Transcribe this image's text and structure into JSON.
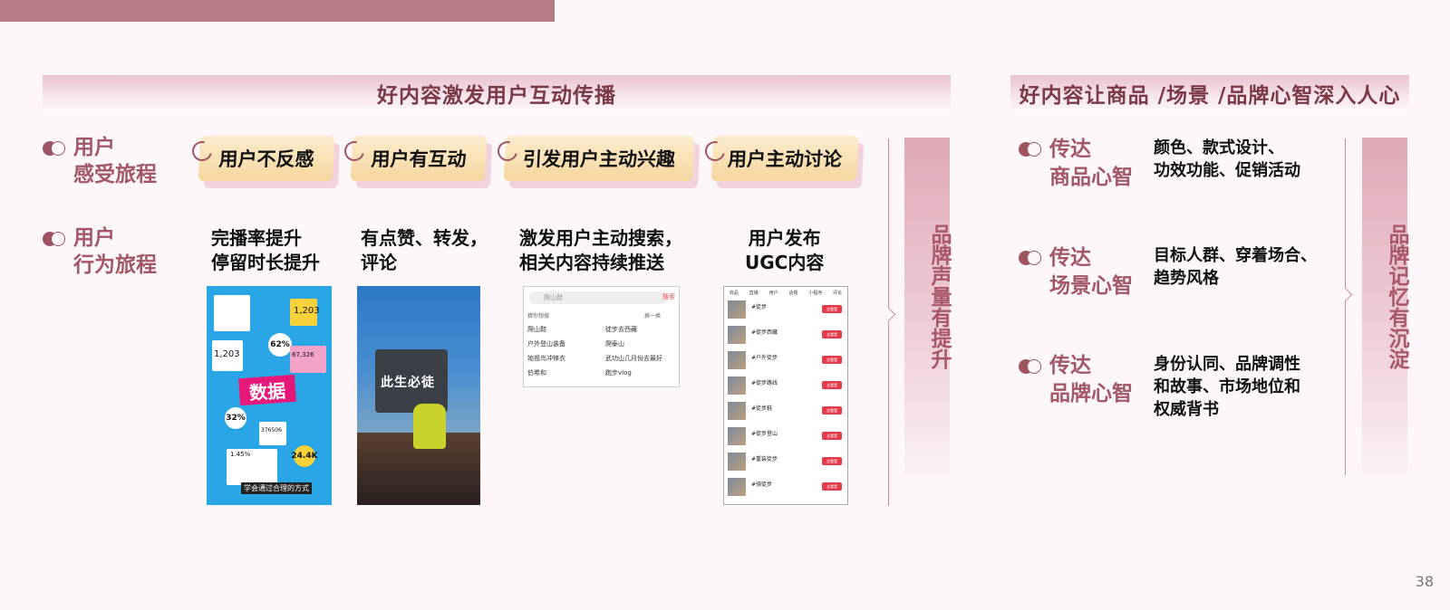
{
  "headers": {
    "left": "好内容激发用户互动传播",
    "right": "好内容让商品 /场景 /品牌心智深入人心"
  },
  "rows": {
    "feeling": "用户\n感受旅程",
    "behavior": "用户\n行为旅程"
  },
  "tags": [
    "用户不反感",
    "用户有互动",
    "引发用户主动兴趣",
    "用户主动讨论"
  ],
  "behaviors": [
    "完播率提升\n停留时长提升",
    "有点赞、转发，\n评论",
    "激发用户主动搜索，\n相关内容持续推送",
    "用户发布\nUGC内容"
  ],
  "screens": {
    "data_card": {
      "big_word": "数据",
      "num1": "1,203",
      "num2": "1,203",
      "pct1": "62%",
      "pct2": "32%",
      "num3": "67,326",
      "num4": "376506",
      "num5": "24.4K",
      "pct3": "1.45%",
      "caption": "学会通过合理的方式"
    },
    "video": {
      "sign": "此生必徒"
    },
    "search": {
      "placeholder": "爬山鞋",
      "search_btn": "搜索",
      "guess": "猜你想搜",
      "refresh": "换一换",
      "items": [
        "爬山鞋",
        "徒步去西藏",
        "户外登山装备",
        "爬泰山",
        "始祖鸟冲锋衣",
        "武功山几月份去最好",
        "伯希和",
        "跑步vlog"
      ]
    },
    "list": {
      "tabs": [
        "商品",
        "直播",
        "用户",
        "话题",
        "小程序",
        "评论"
      ],
      "rows": [
        "#徒步",
        "#徒步西藏",
        "#户外徒步",
        "#徒步路线",
        "#徒步鞋",
        "#徒步登山",
        "#重装徒步",
        "#骑徒步"
      ],
      "button": "去看看"
    }
  },
  "left_vertical": "品牌声量有提升",
  "right_vertical": "品牌记忆有沉淀",
  "right_items": [
    {
      "label": "传达\n商品心智",
      "desc": "颜色、款式设计、\n功效功能、促销活动"
    },
    {
      "label": "传达\n场景心智",
      "desc": "目标人群、穿着场合、\n趋势风格"
    },
    {
      "label": "传达\n品牌心智",
      "desc": "身份认同、品牌调性\n和故事、市场地位和\n权威背书"
    }
  ],
  "page_number": "38",
  "colors": {
    "accent": "#a25868",
    "top_bar": "#b57d84",
    "tag": "#f6d79d"
  }
}
